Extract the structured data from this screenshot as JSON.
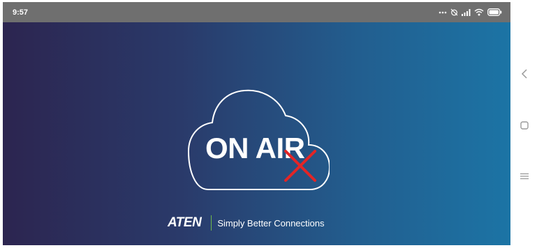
{
  "status_bar": {
    "time": "9:57",
    "icons": [
      "more-dots-icon",
      "alarm-off-icon",
      "signal-icon",
      "wifi-icon",
      "battery-icon"
    ]
  },
  "app": {
    "logo_text": "ON AIR",
    "logo_status_icon": "x-mark-icon",
    "brand": "ATEN",
    "tagline": "Simply Better Connections",
    "colors": {
      "gradient_start": "#2c2550",
      "gradient_end": "#1c74a5",
      "x_mark": "#e32526",
      "divider": "#6fb84a"
    }
  },
  "nav_bar": {
    "buttons": [
      "back-icon",
      "home-icon",
      "menu-icon"
    ]
  }
}
